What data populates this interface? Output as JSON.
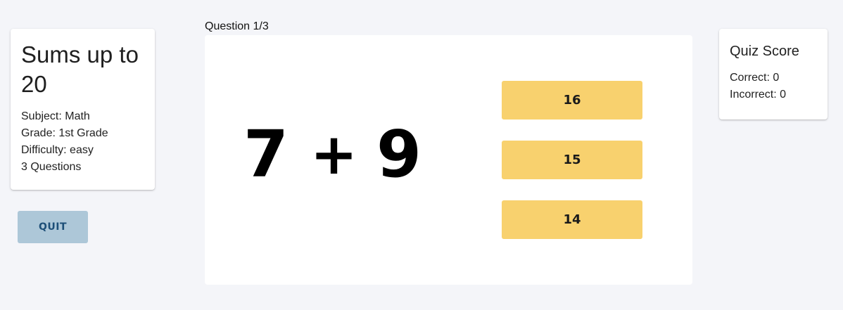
{
  "quiz": {
    "title": "Sums up to 20",
    "subject": "Subject: Math",
    "grade": "Grade: 1st Grade",
    "difficulty": "Difficulty: easy",
    "question_count": "3 Questions"
  },
  "quit_label": "QUIT",
  "question": {
    "label": "Question 1/3",
    "operand_a": "7",
    "operator": "+",
    "operand_b": "9",
    "answers": [
      "16",
      "15",
      "14"
    ]
  },
  "score": {
    "title": "Quiz Score",
    "correct": "Correct: 0",
    "incorrect": "Incorrect: 0"
  },
  "colors": {
    "background": "#f4f5f9",
    "answer_button": "#f8d16e",
    "quit_button": "#adc7d8",
    "quit_text": "#1d4f78"
  }
}
